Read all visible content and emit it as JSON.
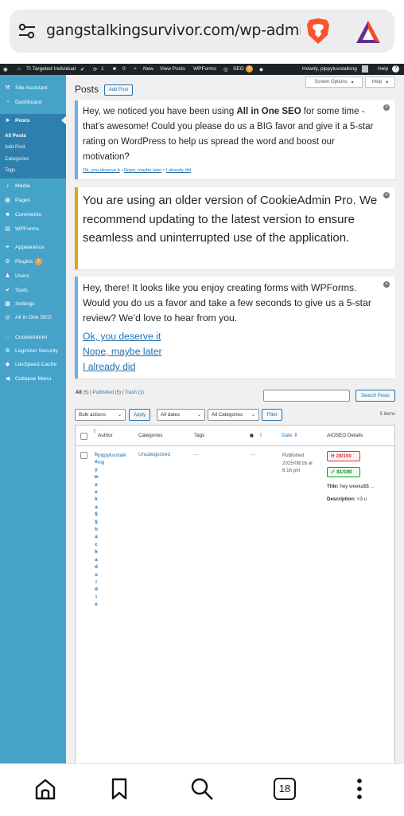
{
  "browser": {
    "url": "gangstalkingsurvivor.com/wp-admin/edi",
    "tab_count": "18"
  },
  "adminbar": {
    "site_name": "TI Targeted Individual",
    "updates": "1",
    "comments": "0",
    "new_label": "New",
    "view_posts": "View Posts",
    "wpforms": "WPForms",
    "seo": "SEO",
    "seo_badge": "3",
    "howdy": "Howdy, pippyluvstalking",
    "help": "Help"
  },
  "sidebar": {
    "items": [
      {
        "label": "Site Assistant",
        "icon": "wrench-icon"
      },
      {
        "label": "Dashboard",
        "icon": "dashboard-icon"
      },
      {
        "label": "Posts",
        "icon": "pin-icon"
      },
      {
        "label": "Media",
        "icon": "media-icon"
      },
      {
        "label": "Pages",
        "icon": "pages-icon"
      },
      {
        "label": "Comments",
        "icon": "comments-icon"
      },
      {
        "label": "WPForms",
        "icon": "forms-icon"
      },
      {
        "label": "Appearance",
        "icon": "brush-icon"
      },
      {
        "label": "Plugins",
        "icon": "plugin-icon",
        "badge": "1"
      },
      {
        "label": "Users",
        "icon": "users-icon"
      },
      {
        "label": "Tools",
        "icon": "tools-icon"
      },
      {
        "label": "Settings",
        "icon": "settings-icon"
      },
      {
        "label": "All in One SEO",
        "icon": "seo-icon"
      },
      {
        "label": "CookieAdmin",
        "icon": "cookie-icon"
      },
      {
        "label": "Loginizer Security",
        "icon": "gear-icon"
      },
      {
        "label": "LiteSpeed Cache",
        "icon": "diamond-icon"
      },
      {
        "label": "Collapse Menu",
        "icon": "collapse-icon"
      }
    ],
    "posts_sub": [
      "All Posts",
      "Add Post",
      "Categories",
      "Tags"
    ]
  },
  "page": {
    "title": "Posts",
    "add_post": "Add Post",
    "screen_options": "Screen Options",
    "help": "Help"
  },
  "notices": {
    "aioseo": {
      "text_1": "Hey, we noticed you have been using ",
      "text_bold": "All in One SEO",
      "text_2": " for some time - that’s awesome! Could you please do us a BIG favor and give it a 5-star rating on WordPress to help us spread the word and boost our motivation?",
      "link_1": "Ok, you deserve it",
      "link_2": "Nope, maybe later",
      "link_3": "I already did",
      "sep": "•"
    },
    "cookieadmin": {
      "text": "You are using an older version of CookieAdmin Pro. We recommend updating to the latest version to ensure seamless and uninterrupted use of the application."
    },
    "wpforms": {
      "text": "Hey, there! It looks like you enjoy creating forms with WPForms. Would you do us a favor and take a few seconds to give us a 5-star review? We’d love to hear from you.",
      "link_1": "Ok, you deserve it",
      "link_2": "Nope, maybe later",
      "link_3": "I already did"
    }
  },
  "filters": {
    "all": "All",
    "all_count": "(5)",
    "published": "Published",
    "published_count": "(5)",
    "trash": "Trash",
    "trash_count": "(1)",
    "sep": "|",
    "search_button": "Search Posts",
    "bulk_actions": "Bulk actions",
    "apply": "Apply",
    "all_dates": "All dates",
    "all_categories": "All Categories",
    "filter": "Filter",
    "items_count": "5 items"
  },
  "table": {
    "headers": {
      "title_char": "T",
      "author": "Author",
      "categories": "Categories",
      "tags": "Tags",
      "date": "Date",
      "aioseo": "AIOSEO Details"
    },
    "row": {
      "title_chars": [
        "h",
        "e",
        "y",
        "w",
        "e",
        "e",
        "k",
        "a",
        "$",
        "$",
        "h",
        "a",
        "c",
        "k",
        "a",
        "d",
        "o",
        "i",
        "d",
        "l",
        "e"
      ],
      "author_1": "pippyluvstalk",
      "author_2": "ing",
      "categories": "Uncategorized",
      "tags": "—",
      "comments": "—",
      "date_status": "Published",
      "date_value": "2025/08/16 at",
      "date_time": "8:16 pm",
      "score_red": "28/100",
      "score_green": "81/100",
      "seo_title_label": "Title:",
      "seo_title_value": "hey weeka$$ ...",
      "seo_desc_label": "Description:",
      "seo_desc_value": "<3 u"
    }
  },
  "colors": {
    "sidebar": "#45a3c9",
    "sidebar_current": "#2f7fae",
    "adminbar": "#1d2327",
    "link": "#2271b1",
    "notice_info": "#72aee6",
    "notice_warn": "#dba617"
  }
}
